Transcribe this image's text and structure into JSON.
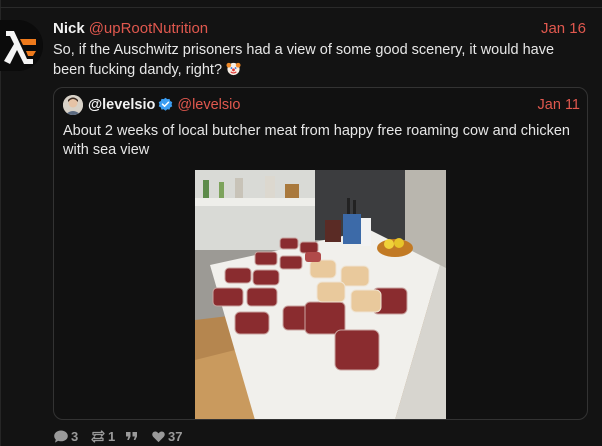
{
  "post": {
    "author": "Nick",
    "handle": "@upRootNutrition",
    "date": "Jan 16",
    "text": "So, if the Auschwitz prisoners had a view of some good scenery, it would have been fucking dandy, right?",
    "emoji_icon": "clown-face-icon"
  },
  "quote": {
    "author": "@levelsio",
    "handle": "@levelsio",
    "date": "Jan 11",
    "text": "About 2 weeks of local butcher meat from happy free roaming cow and chicken with sea view",
    "verified_icon": "verified-badge-icon",
    "image": "meat-on-kitchen-counter-photo"
  },
  "actions": {
    "replies": "3",
    "reposts": "1",
    "quotes_icon": "quote-icon",
    "likes": "37"
  },
  "colors": {
    "background": "#131313",
    "accent": "#e0584e",
    "text": "#e7e7e7",
    "muted": "#9a9a9a"
  }
}
